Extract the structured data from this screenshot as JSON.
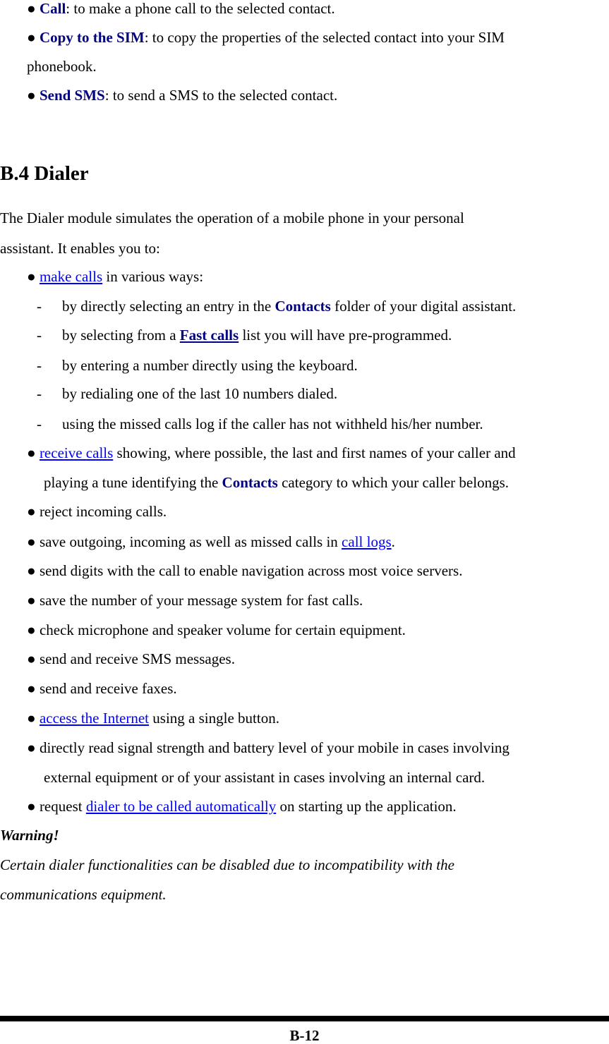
{
  "top_bullets": [
    {
      "term": "Call",
      "desc": ": to make a phone call to the selected contact."
    },
    {
      "term": "Copy to the SIM",
      "desc": ": to copy the properties of the selected contact into your SIM",
      "cont": "phonebook."
    },
    {
      "term": "Send SMS",
      "desc": ": to send a SMS to the selected contact."
    }
  ],
  "bullet_glyph": "●",
  "dash_glyph": "-",
  "section": {
    "title": "B.4 Dialer",
    "intro_line1": "The Dialer module simulates the operation of a mobile phone in your personal",
    "intro_line2": "assistant. It enables you to:"
  },
  "make_calls": {
    "link": "make calls",
    "rest": " in various ways:"
  },
  "sub_items": [
    {
      "pre": "by directly selecting an entry in the ",
      "bold": "Contacts",
      "post": " folder of your digital assistant."
    },
    {
      "pre": "by selecting from a ",
      "boldlink": "Fast calls",
      "post": " list you will have pre-programmed."
    },
    {
      "text": "by entering a number directly using the keyboard."
    },
    {
      "text": "by redialing one of the last 10 numbers dialed."
    },
    {
      "text": "using the missed calls log if the caller has not withheld his/her number."
    }
  ],
  "receive": {
    "link": "receive calls",
    "rest": " showing, where possible, the last and first names of your caller and",
    "cont_pre": "playing a tune identifying the ",
    "cont_bold": "Contacts",
    "cont_post": " category to which your caller belongs."
  },
  "reject": "reject incoming calls.",
  "save_logs": {
    "pre": "save outgoing, incoming as well as missed calls in ",
    "link": "call logs",
    "post": "."
  },
  "plain_items": [
    "send digits with the call to enable navigation across most voice servers.",
    "save the number of your message system for fast calls.",
    "check microphone and speaker volume for certain equipment.",
    "send and receive SMS messages.",
    "send and receive faxes."
  ],
  "internet": {
    "link": "access the Internet",
    "rest": " using a single button."
  },
  "signal": {
    "line1": "directly read signal strength and battery level of your mobile in cases involving",
    "line2": "external equipment or of your assistant in cases involving an internal card."
  },
  "request": {
    "pre": "request ",
    "link": "dialer to be called automatically",
    "post": " on starting up the application."
  },
  "warning": {
    "title": "Warning!",
    "line1": "Certain dialer functionalities can be disabled due to incompatibility with the",
    "line2": "communications equipment."
  },
  "footer": {
    "page": "B-12"
  },
  "colors": {
    "bold_term": "#000080",
    "link": "#0000ff"
  }
}
